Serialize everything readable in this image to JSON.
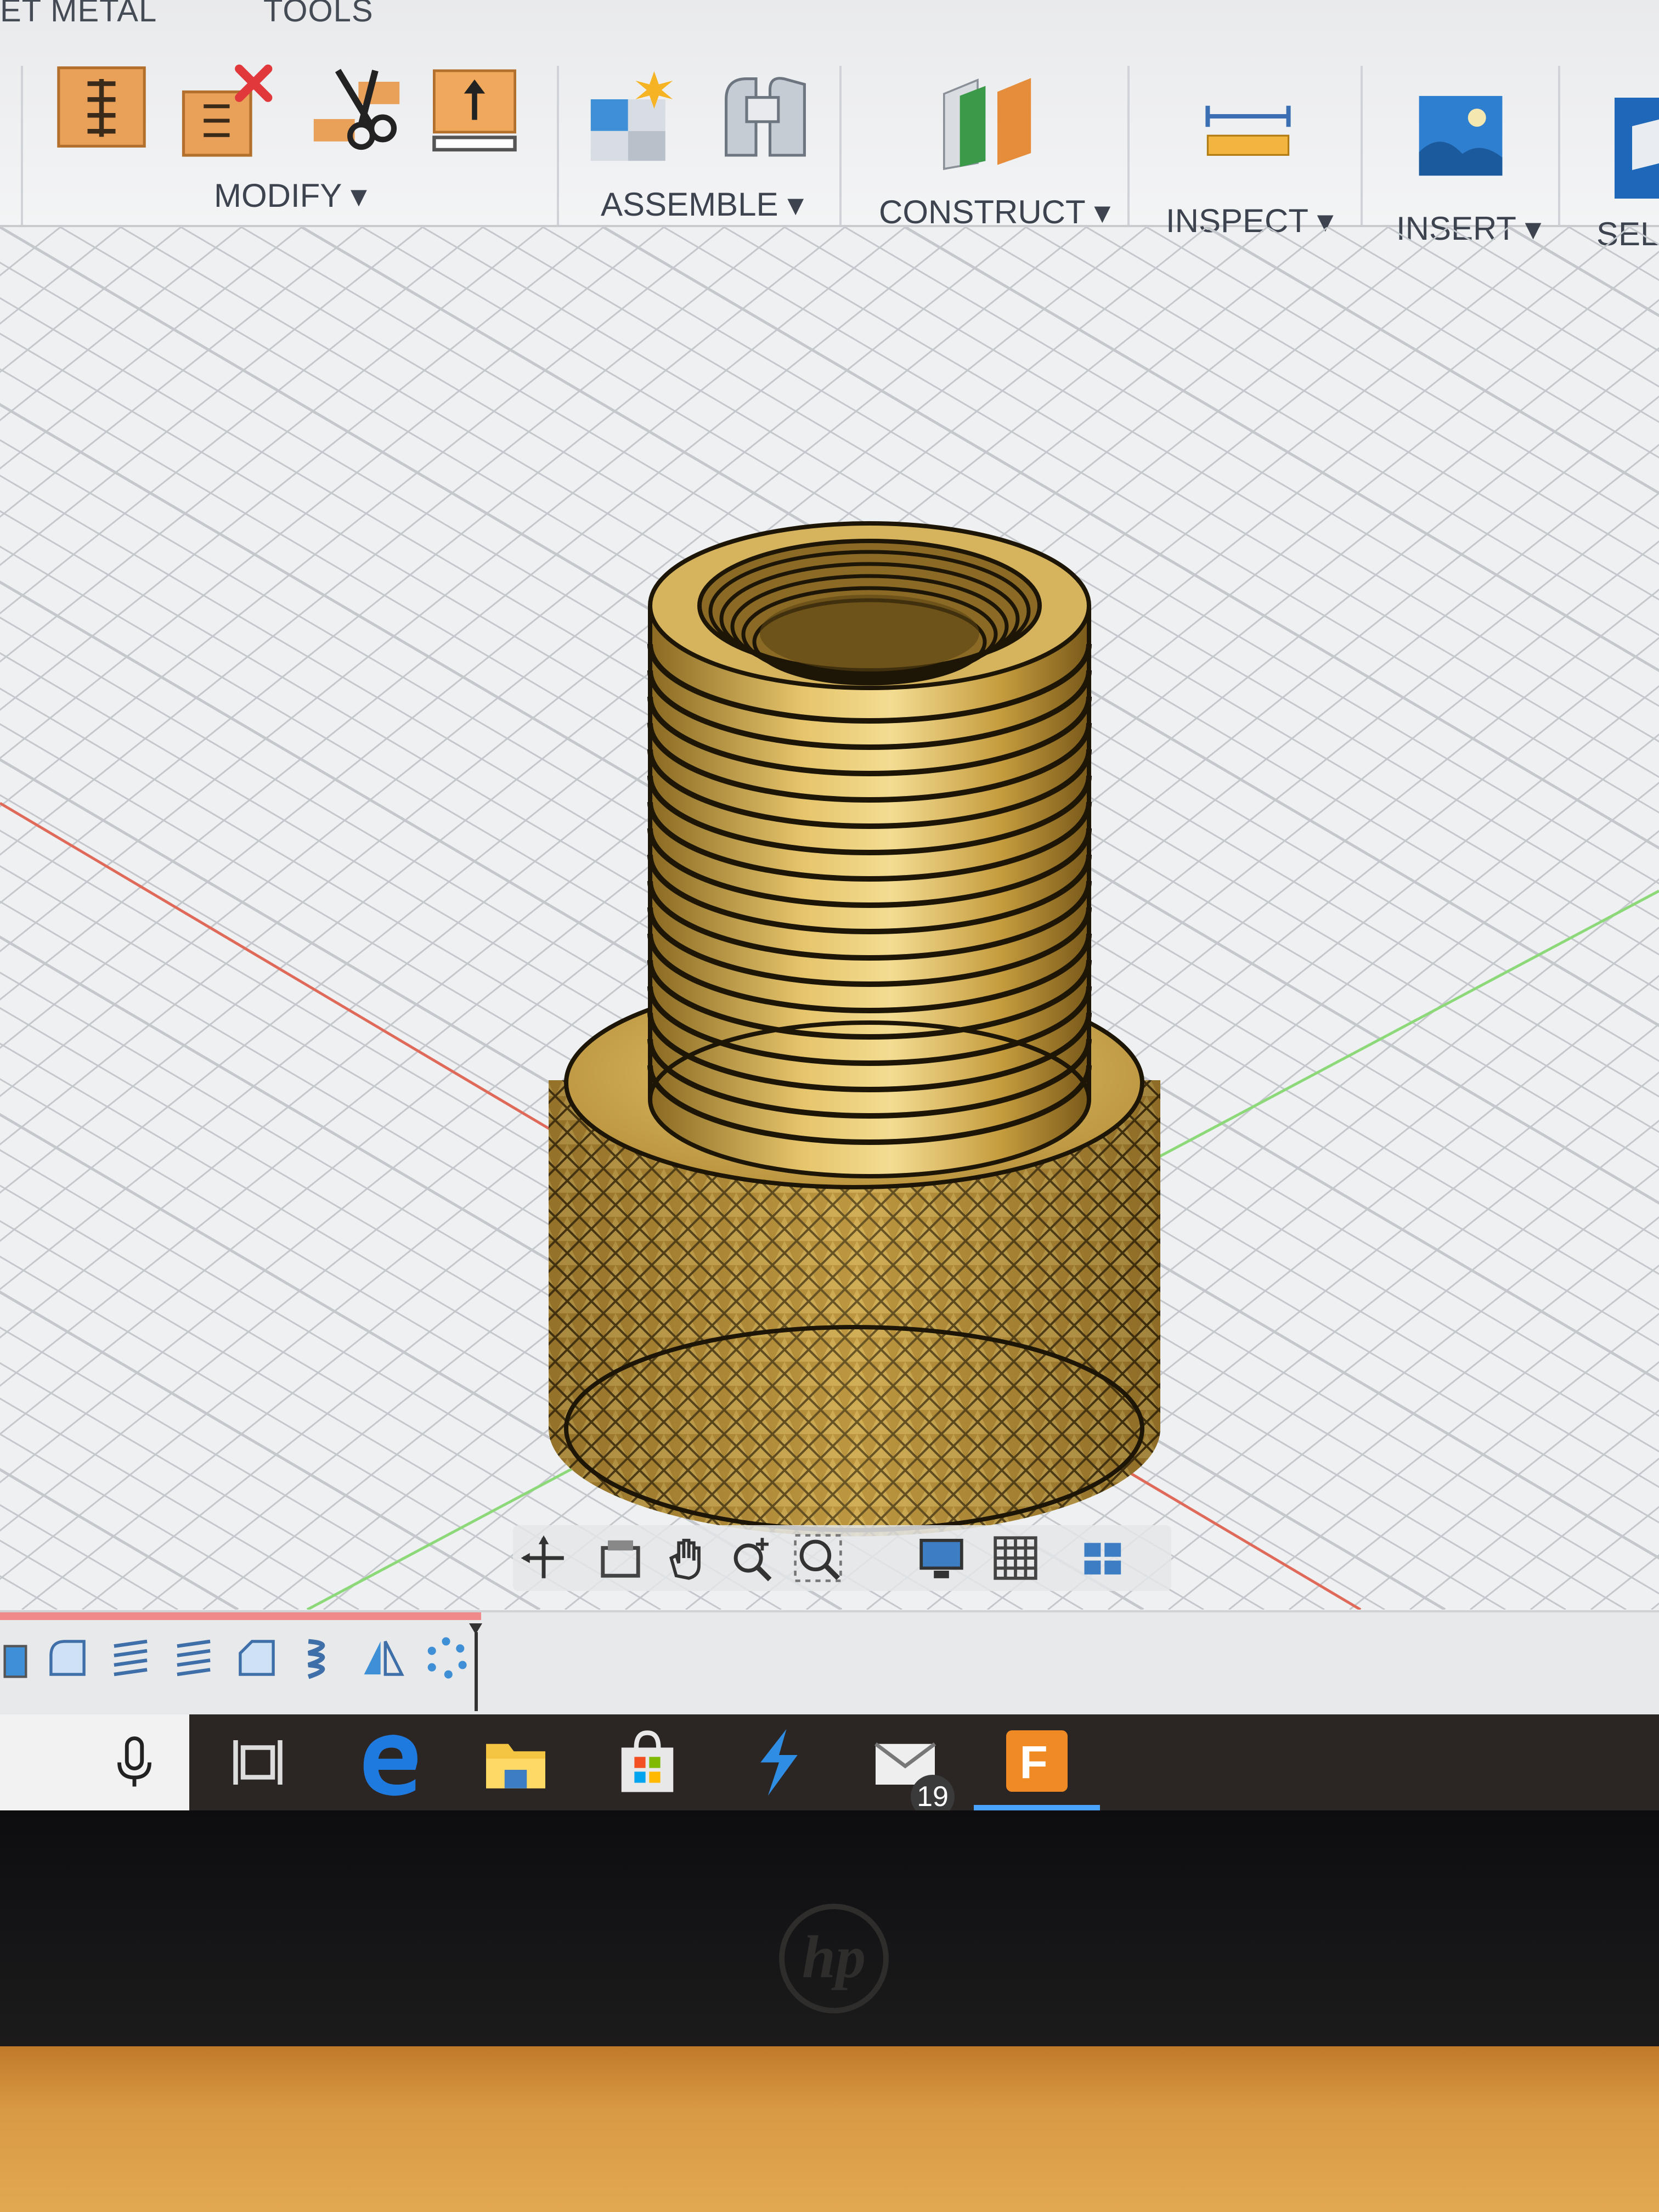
{
  "ribbon": {
    "tabs": [
      "ET METAL",
      "TOOLS"
    ],
    "groups": [
      {
        "label": "MODIFY ▾"
      },
      {
        "label": "ASSEMBLE ▾"
      },
      {
        "label": "CONSTRUCT ▾"
      },
      {
        "label": "INSPECT ▾"
      },
      {
        "label": "INSERT ▾"
      },
      {
        "label": "SELE"
      }
    ],
    "tools": [
      "press-pull-icon",
      "delete-icon",
      "split-body-icon",
      "offset-face-icon",
      "new-component-icon",
      "joint-icon",
      "offset-plane-icon",
      "measure-icon",
      "insert-image-icon",
      "select-icon"
    ]
  },
  "model": {
    "description_icon": "knurled-threaded-adapter",
    "colors": {
      "gold_light": "#e8c36a",
      "gold_mid": "#c9a34a",
      "gold_dark": "#7e5e1c",
      "edge": "#1d1606"
    }
  },
  "navbar": {
    "tools": [
      "orbit-icon",
      "look-at-icon",
      "pan-icon",
      "zoom-icon",
      "fit-icon",
      "display-settings-icon",
      "grid-settings-icon",
      "viewports-icon"
    ]
  },
  "timeline": {
    "progress": 0.29,
    "features": [
      "extrude-icon",
      "fillet-icon",
      "thread-icon",
      "thread-icon",
      "chamfer-icon",
      "coil-icon",
      "mirror-icon",
      "pattern-icon"
    ]
  },
  "taskbar": {
    "apps": [
      "microphone-icon",
      "task-view-icon",
      "edge-icon",
      "file-explorer-icon",
      "store-icon",
      "app-bolt-icon",
      "mail-icon",
      "fusion-360-icon"
    ],
    "mail_badge": "19"
  },
  "bezel": {
    "logo": "hp"
  }
}
